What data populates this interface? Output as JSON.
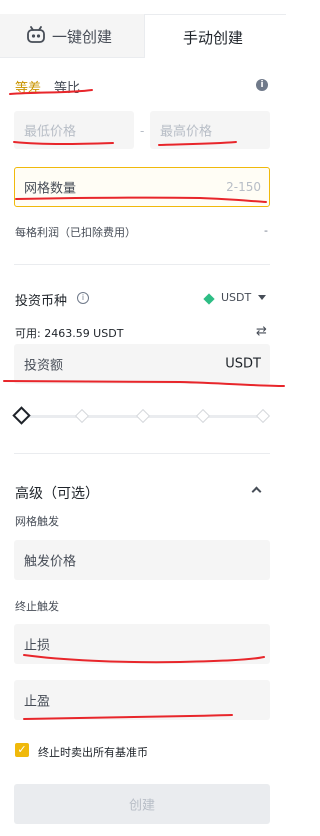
{
  "tabs": {
    "quick_create": "一键创建",
    "manual_create": "手动创建"
  },
  "mode": {
    "arithmetic": "等差",
    "geometric": "等比"
  },
  "price_range": {
    "min_placeholder": "最低价格",
    "separator": "-",
    "max_placeholder": "最高价格"
  },
  "grid": {
    "label": "网格数量",
    "range": "2-150"
  },
  "profit": {
    "label": "每格利润（已扣除费用）",
    "value": "-"
  },
  "investment": {
    "currency_label": "投资币种",
    "currency": "USDT",
    "available": "可用: 2463.59 USDT",
    "amount_placeholder": "投资额",
    "amount_unit": "USDT"
  },
  "advanced": {
    "title": "高级（可选）",
    "grid_trigger_label": "网格触发",
    "trigger_price_placeholder": "触发价格",
    "stop_trigger_label": "终止触发",
    "stop_loss_placeholder": "止损",
    "take_profit_placeholder": "止盈",
    "sell_all_label": "终止时卖出所有基准币",
    "sell_all_checked": true
  },
  "create_button": "创建",
  "colors": {
    "accent": "#f0b90b",
    "active_text": "#c99400",
    "annotation": "#e8262b"
  },
  "icons": {
    "bot": "robot-icon",
    "info": "info-icon",
    "coin": "diamond-icon",
    "swap": "swap-icon",
    "expand": "chevron-up-icon",
    "check": "check-icon"
  },
  "slider": {
    "value": 0,
    "stops": 5
  }
}
